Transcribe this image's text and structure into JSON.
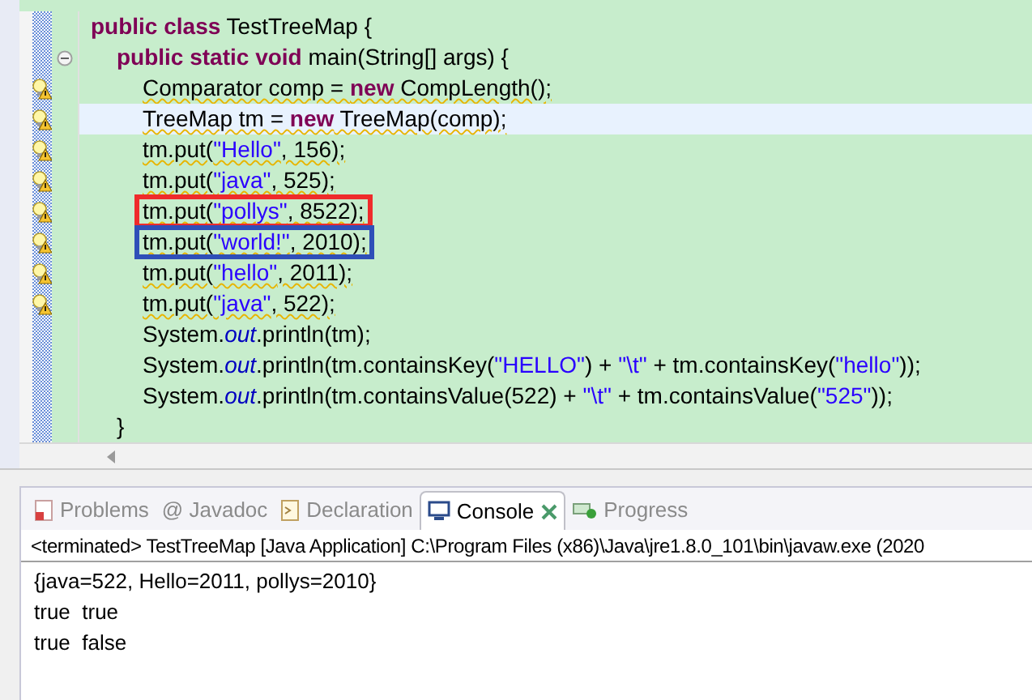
{
  "editor": {
    "lines": [
      {
        "warning": false,
        "current": false,
        "foldable": false,
        "tokens": [
          {
            "kind": "keyword",
            "text": "public class"
          },
          {
            "kind": "plain",
            "text": " TestTreeMap {"
          }
        ],
        "children": [
          {
            "warning": false,
            "current": false,
            "foldable": true,
            "tokens": [
              {
                "kind": "keyword",
                "text": "public static void"
              },
              {
                "kind": "plain",
                "text": " main(String[] args) {"
              }
            ],
            "children": [
              {
                "warning": true,
                "current": false,
                "foldable": false,
                "tokens": [
                  {
                    "kind": "plain",
                    "text": "Comparator comp = "
                  },
                  {
                    "kind": "keyword",
                    "text": "new"
                  },
                  {
                    "kind": "plain",
                    "text": " CompLength();"
                  }
                ]
              },
              {
                "warning": true,
                "current": true,
                "foldable": false,
                "tokens": [
                  {
                    "kind": "plain",
                    "text": "TreeMap tm = "
                  },
                  {
                    "kind": "keyword",
                    "text": "new"
                  },
                  {
                    "kind": "plain",
                    "text": " TreeMap(comp);"
                  }
                ]
              },
              {
                "warning": true,
                "current": false,
                "foldable": false,
                "tokens": [
                  {
                    "kind": "plain",
                    "text": "tm.put("
                  },
                  {
                    "kind": "string",
                    "text": "\"Hello\""
                  },
                  {
                    "kind": "plain",
                    "text": ", 156);"
                  }
                ]
              },
              {
                "warning": true,
                "current": false,
                "foldable": false,
                "tokens": [
                  {
                    "kind": "plain",
                    "text": "tm.put("
                  },
                  {
                    "kind": "string",
                    "text": "\"java\""
                  },
                  {
                    "kind": "plain",
                    "text": ", 525);"
                  }
                ]
              },
              {
                "warning": true,
                "current": false,
                "foldable": false,
                "color": "#ef2b2b",
                "tokens": [
                  {
                    "kind": "plain",
                    "text": "tm.put("
                  },
                  {
                    "kind": "string",
                    "text": "\"pollys\""
                  },
                  {
                    "kind": "plain",
                    "text": ", 8522);"
                  }
                ]
              },
              {
                "warning": true,
                "current": false,
                "foldable": false,
                "color": "#2f4fb8",
                "tokens": [
                  {
                    "kind": "plain",
                    "text": "tm.put("
                  },
                  {
                    "kind": "string",
                    "text": "\"world!\""
                  },
                  {
                    "kind": "plain",
                    "text": ", 2010);"
                  }
                ]
              },
              {
                "warning": true,
                "current": false,
                "foldable": false,
                "tokens": [
                  {
                    "kind": "plain",
                    "text": "tm.put("
                  },
                  {
                    "kind": "string",
                    "text": "\"hello\""
                  },
                  {
                    "kind": "plain",
                    "text": ", 2011);"
                  }
                ]
              },
              {
                "warning": true,
                "current": false,
                "foldable": false,
                "tokens": [
                  {
                    "kind": "plain",
                    "text": "tm.put("
                  },
                  {
                    "kind": "string",
                    "text": "\"java\""
                  },
                  {
                    "kind": "plain",
                    "text": ", 522);"
                  }
                ]
              },
              {
                "warning": false,
                "current": false,
                "foldable": false,
                "tokens": [
                  {
                    "kind": "plain",
                    "text": "System."
                  },
                  {
                    "kind": "field",
                    "text": "out"
                  },
                  {
                    "kind": "plain",
                    "text": ".println(tm);"
                  }
                ]
              },
              {
                "warning": false,
                "current": false,
                "foldable": false,
                "tokens": [
                  {
                    "kind": "plain",
                    "text": "System."
                  },
                  {
                    "kind": "field",
                    "text": "out"
                  },
                  {
                    "kind": "plain",
                    "text": ".println(tm.containsKey("
                  },
                  {
                    "kind": "string",
                    "text": "\"HELLO\""
                  },
                  {
                    "kind": "plain",
                    "text": ") + "
                  },
                  {
                    "kind": "string",
                    "text": "\"\\t\""
                  },
                  {
                    "kind": "plain",
                    "text": " + tm.containsKey("
                  },
                  {
                    "kind": "string",
                    "text": "\"hello\""
                  },
                  {
                    "kind": "plain",
                    "text": "));"
                  }
                ]
              },
              {
                "warning": false,
                "current": false,
                "foldable": false,
                "tokens": [
                  {
                    "kind": "plain",
                    "text": "System."
                  },
                  {
                    "kind": "field",
                    "text": "out"
                  },
                  {
                    "kind": "plain",
                    "text": ".println(tm.containsValue(522) + "
                  },
                  {
                    "kind": "string",
                    "text": "\"\\t\""
                  },
                  {
                    "kind": "plain",
                    "text": " + tm.containsValue("
                  },
                  {
                    "kind": "string",
                    "text": "\"525\""
                  },
                  {
                    "kind": "plain",
                    "text": "));"
                  }
                ]
              }
            ]
          },
          {
            "warning": false,
            "current": false,
            "foldable": false,
            "tokens": [
              {
                "kind": "plain",
                "text": "}"
              }
            ]
          }
        ]
      }
    ]
  },
  "panel": {
    "tabs": [
      {
        "kind": "problems",
        "label": "Problems",
        "selected": false
      },
      {
        "kind": "javadoc",
        "label": "@ Javadoc",
        "selected": false
      },
      {
        "kind": "declaration",
        "label": "Declaration",
        "selected": false
      },
      {
        "kind": "console",
        "label": "Console",
        "selected": true
      },
      {
        "kind": "progress",
        "label": "Progress",
        "selected": false
      }
    ],
    "console_header": "<terminated> TestTreeMap [Java Application] C:\\Program Files (x86)\\Java\\jre1.8.0_101\\bin\\javaw.exe (2020",
    "output": [
      "{java=522, Hello=2011, pollys=2010}",
      "true  true",
      "true  false"
    ]
  }
}
